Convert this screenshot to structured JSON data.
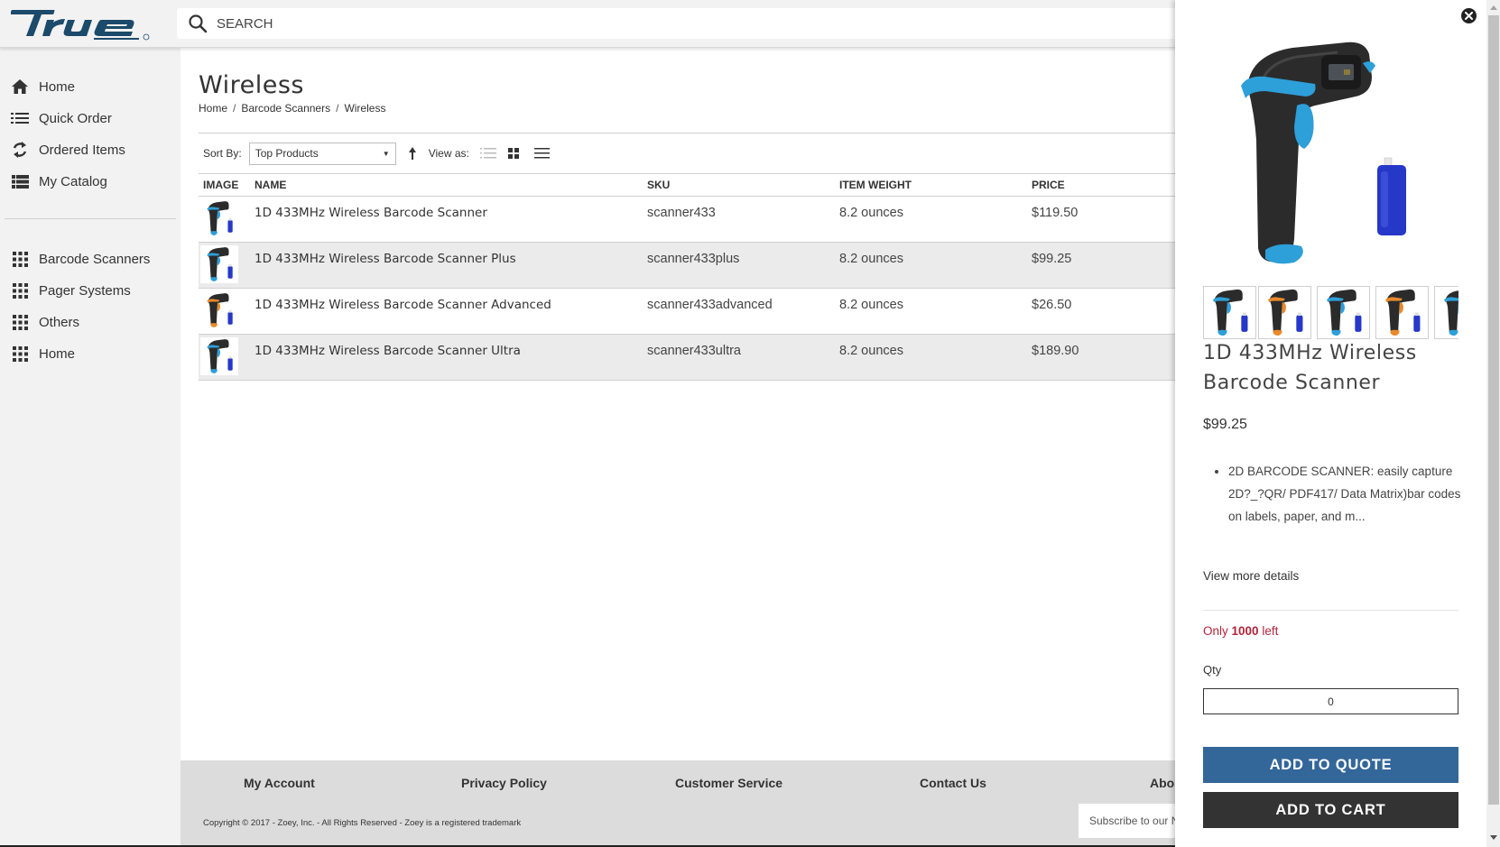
{
  "header": {
    "logo_text": "true",
    "logo_icon": "true-brand-logo",
    "search_icon": "search-icon",
    "search_placeholder": "SEARCH",
    "search_value": ""
  },
  "sidebar": {
    "primary": [
      {
        "label": "Home",
        "icon": "home-icon"
      },
      {
        "label": "Quick Order",
        "icon": "list-icon"
      },
      {
        "label": "Ordered Items",
        "icon": "refresh-icon"
      },
      {
        "label": "My Catalog",
        "icon": "catalog-list-icon"
      }
    ],
    "categories": [
      {
        "label": "Barcode Scanners",
        "icon": "grid-icon"
      },
      {
        "label": "Pager Systems",
        "icon": "grid-icon"
      },
      {
        "label": "Others",
        "icon": "grid-icon"
      },
      {
        "label": "Home",
        "icon": "grid-icon"
      }
    ]
  },
  "main": {
    "title": "Wireless",
    "breadcrumb": [
      "Home",
      "Barcode Scanners",
      "Wireless"
    ],
    "breadcrumb_sep": "/",
    "toolbar": {
      "sort_label": "Sort By:",
      "sort_value": "Top Products",
      "sort_direction_icon": "arrow-up-icon",
      "view_label": "View as:",
      "view_modes": [
        "list-view-icon",
        "grid-view-icon",
        "table-view-icon"
      ],
      "active_view": "table-view-icon"
    },
    "table": {
      "columns": [
        "IMAGE",
        "NAME",
        "SKU",
        "ITEM WEIGHT",
        "PRICE"
      ],
      "rows": [
        {
          "name": "1D 433MHz Wireless Barcode Scanner",
          "sku": "scanner433",
          "weight": "8.2 ounces",
          "price": "$119.50",
          "accent": "#2d9fd9"
        },
        {
          "name": "1D 433MHz Wireless Barcode Scanner Plus",
          "sku": "scanner433plus",
          "weight": "8.2 ounces",
          "price": "$99.25",
          "accent": "#2d9fd9"
        },
        {
          "name": "1D 433MHz Wireless Barcode Scanner Advanced",
          "sku": "scanner433advanced",
          "weight": "8.2 ounces",
          "price": "$26.50",
          "accent": "#e8892a"
        },
        {
          "name": "1D 433MHz Wireless Barcode Scanner Ultra",
          "sku": "scanner433ultra",
          "weight": "8.2 ounces",
          "price": "$189.90",
          "accent": "#2d9fd9"
        }
      ]
    }
  },
  "footer": {
    "links": [
      "My Account",
      "Privacy Policy",
      "Customer Service",
      "Contact Us",
      "Abou"
    ],
    "copyright": "Copyright © 2017 - Zoey, Inc. - All Rights Reserved - Zoey is a registered trademark",
    "subscribe_placeholder": "Subscribe to our N"
  },
  "drawer": {
    "close_icon": "close-icon",
    "thumbnails": [
      {
        "accent": "#2d9fd9"
      },
      {
        "accent": "#e8892a"
      },
      {
        "accent": "#2d9fd9"
      },
      {
        "accent": "#e8892a"
      },
      {
        "accent": "#2d9fd9"
      }
    ],
    "product_title": "1D 433MHz Wireless Barcode Scanner",
    "price": "$99.25",
    "description": "2D BARCODE SCANNER: easily capture 2D?_?QR/ PDF417/ Data Matrix)bar codes on labels, paper, and m...",
    "view_more": "View more details",
    "stock_prefix": "Only",
    "stock_count": "1000",
    "stock_suffix": "left",
    "qty_label": "Qty",
    "qty_value": "0",
    "add_to_quote": "ADD TO QUOTE",
    "add_to_cart": "ADD TO CART"
  },
  "colors": {
    "brand": "#1b4a6b",
    "quote_button": "#336699",
    "cart_button": "#333333",
    "stock_text": "#b2243c",
    "scanner_blue": "#2d9fd9"
  }
}
